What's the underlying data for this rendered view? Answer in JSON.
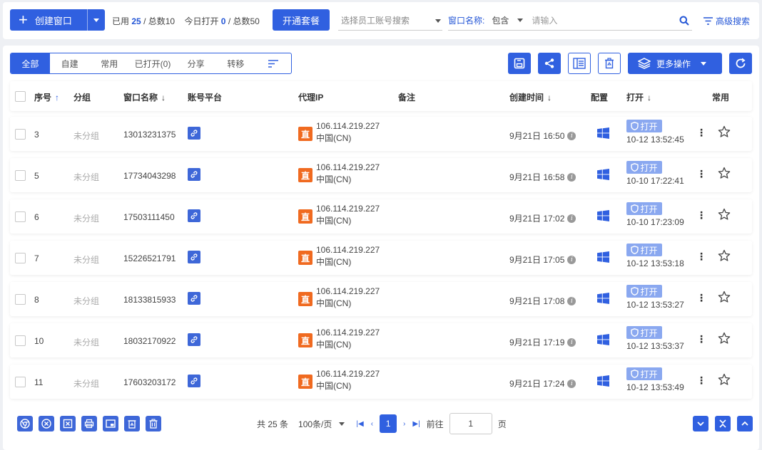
{
  "toolbar": {
    "create_label": "创建窗口",
    "used_label": "已用",
    "used_value": "25",
    "total_label": "/ 总数10",
    "today_label": "今日打开",
    "today_value": "0",
    "today_total_label": "/ 总数50",
    "open_plan_label": "开通套餐",
    "employee_placeholder": "选择员工账号搜索",
    "window_name_label": "窗口名称:",
    "match_mode": "包含",
    "search_placeholder": "请输入",
    "advanced_search_label": "高级搜索"
  },
  "tabs": [
    {
      "label": "全部",
      "active": true
    },
    {
      "label": "自建",
      "active": false
    },
    {
      "label": "常用",
      "active": false
    },
    {
      "label": "已打开(0)",
      "active": false
    },
    {
      "label": "分享",
      "active": false
    },
    {
      "label": "转移",
      "active": false
    }
  ],
  "actions": {
    "more_ops_label": "更多操作"
  },
  "columns": {
    "seq": "序号",
    "group": "分组",
    "window_name": "窗口名称",
    "platform": "账号平台",
    "proxy_ip": "代理IP",
    "remark": "备注",
    "created": "创建时间",
    "config": "配置",
    "open": "打开",
    "favorite": "常用"
  },
  "rows": [
    {
      "seq": "3",
      "group": "未分组",
      "name": "13013231375",
      "proxy_tag": "直",
      "ip": "106.114.219.227",
      "region": "中国(CN)",
      "created": "9月21日 16:50",
      "open_label": "打开",
      "open_time": "10-12 13:52:45"
    },
    {
      "seq": "5",
      "group": "未分组",
      "name": "17734043298",
      "proxy_tag": "直",
      "ip": "106.114.219.227",
      "region": "中国(CN)",
      "created": "9月21日 16:58",
      "open_label": "打开",
      "open_time": "10-10 17:22:41"
    },
    {
      "seq": "6",
      "group": "未分组",
      "name": "17503111450",
      "proxy_tag": "直",
      "ip": "106.114.219.227",
      "region": "中国(CN)",
      "created": "9月21日 17:02",
      "open_label": "打开",
      "open_time": "10-10 17:23:09"
    },
    {
      "seq": "7",
      "group": "未分组",
      "name": "15226521791",
      "proxy_tag": "直",
      "ip": "106.114.219.227",
      "region": "中国(CN)",
      "created": "9月21日 17:05",
      "open_label": "打开",
      "open_time": "10-12 13:53:18"
    },
    {
      "seq": "8",
      "group": "未分组",
      "name": "18133815933",
      "proxy_tag": "直",
      "ip": "106.114.219.227",
      "region": "中国(CN)",
      "created": "9月21日 17:08",
      "open_label": "打开",
      "open_time": "10-12 13:53:27"
    },
    {
      "seq": "10",
      "group": "未分组",
      "name": "18032170922",
      "proxy_tag": "直",
      "ip": "106.114.219.227",
      "region": "中国(CN)",
      "created": "9月21日 17:19",
      "open_label": "打开",
      "open_time": "10-12 13:53:37"
    },
    {
      "seq": "11",
      "group": "未分组",
      "name": "17603203172",
      "proxy_tag": "直",
      "ip": "106.114.219.227",
      "region": "中国(CN)",
      "created": "9月21日 17:24",
      "open_label": "打开",
      "open_time": "10-12 13:53:49"
    }
  ],
  "pagination": {
    "total_label": "共 25 条",
    "page_size_label": "100条/页",
    "current_page": "1",
    "goto_label": "前往",
    "goto_value": "1",
    "page_suffix": "页"
  },
  "colors": {
    "primary": "#3060e0",
    "proxy_tag": "#f06a20",
    "open_badge": "#8aa8f0"
  }
}
